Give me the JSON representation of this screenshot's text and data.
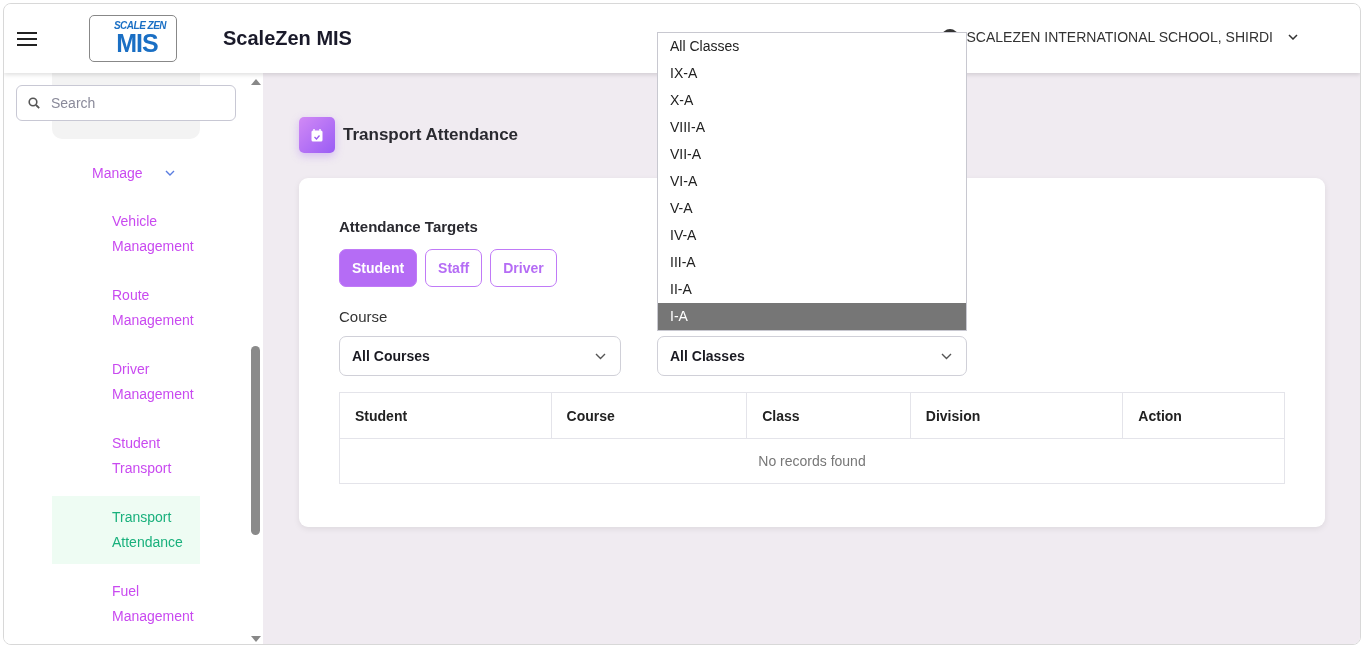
{
  "header": {
    "logo": {
      "line_1": "SCALE ZEN",
      "line_2": "MIS"
    },
    "app_title": "ScaleZen MIS",
    "school": "SCALEZEN INTERNATIONAL SCHOOL, SHIRDI"
  },
  "sidebar": {
    "search": {
      "placeholder": "Search"
    },
    "section": {
      "label": "Manage",
      "expanded": true
    },
    "items": [
      {
        "label": "Vehicle Management",
        "selected": false
      },
      {
        "label": "Route Management",
        "selected": false
      },
      {
        "label": "Driver Management",
        "selected": false
      },
      {
        "label": "Student Transport",
        "selected": false
      },
      {
        "label": "Transport Attendance",
        "selected": true
      },
      {
        "label": "Fuel Management",
        "selected": false
      }
    ]
  },
  "page": {
    "title": "Transport Attendance"
  },
  "card": {
    "targets_label": "Attendance Targets",
    "targets": [
      {
        "label": "Student",
        "selected": true
      },
      {
        "label": "Staff",
        "selected": false
      },
      {
        "label": "Driver",
        "selected": false
      }
    ],
    "course": {
      "label": "Course",
      "value": "All Courses"
    },
    "class": {
      "value": "All Classes",
      "expanded": true,
      "options": [
        {
          "label": "All Classes",
          "highlighted": false
        },
        {
          "label": "IX-A",
          "highlighted": false
        },
        {
          "label": "X-A",
          "highlighted": false
        },
        {
          "label": "VIII-A",
          "highlighted": false
        },
        {
          "label": "VII-A",
          "highlighted": false
        },
        {
          "label": "VI-A",
          "highlighted": false
        },
        {
          "label": "V-A",
          "highlighted": false
        },
        {
          "label": "IV-A",
          "highlighted": false
        },
        {
          "label": "III-A",
          "highlighted": false
        },
        {
          "label": "II-A",
          "highlighted": false
        },
        {
          "label": "I-A",
          "highlighted": true
        }
      ]
    },
    "table": {
      "columns": [
        "Student",
        "Course",
        "Class",
        "Division",
        "Action"
      ],
      "empty_message": "No records found"
    }
  }
}
